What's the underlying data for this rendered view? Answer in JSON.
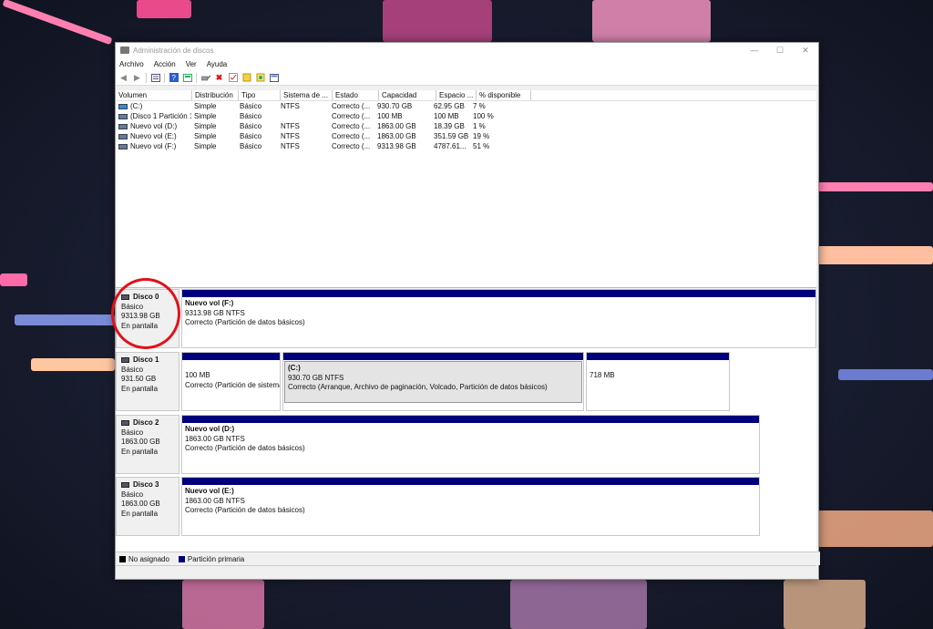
{
  "window": {
    "title": "Administración de discos"
  },
  "menu": [
    "Archivo",
    "Acción",
    "Ver",
    "Ayuda"
  ],
  "toolbar_icons": [
    "back-arrow-icon",
    "forward-arrow-icon",
    "disk-list-icon",
    "help-icon",
    "properties-icon",
    "connect-icon",
    "delete-icon",
    "check-icon",
    "open-folder-icon",
    "rescan-icon",
    "volume-view-icon"
  ],
  "table": {
    "headers": [
      "Volumen",
      "Distribución",
      "Tipo",
      "Sistema de ...",
      "Estado",
      "Capacidad",
      "Espacio ...",
      "% disponible"
    ],
    "rows": [
      [
        "(C:)",
        "Simple",
        "Básico",
        "NTFS",
        "Correcto (...",
        "930.70 GB",
        "62.95 GB",
        "7 %"
      ],
      [
        "(Disco 1 Partición 1)",
        "Simple",
        "Básico",
        "",
        "Correcto (...",
        "100 MB",
        "100 MB",
        "100 %"
      ],
      [
        "Nuevo vol (D:)",
        "Simple",
        "Básico",
        "NTFS",
        "Correcto (...",
        "1863.00 GB",
        "18.39 GB",
        "1 %"
      ],
      [
        "Nuevo vol (E:)",
        "Simple",
        "Básico",
        "NTFS",
        "Correcto (...",
        "1863.00 GB",
        "351.59 GB",
        "19 %"
      ],
      [
        "Nuevo vol (F:)",
        "Simple",
        "Básico",
        "NTFS",
        "Correcto (...",
        "9313.98 GB",
        "4787.61...",
        "51 %"
      ]
    ]
  },
  "disks": [
    {
      "name": "Disco 0",
      "type": "Básico",
      "size": "9313.98 GB",
      "status": "En pantalla",
      "partitions": [
        {
          "name": "Nuevo vol  (F:)",
          "size": "9313.98 GB NTFS",
          "status": "Correcto (Partición de datos básicos)"
        }
      ]
    },
    {
      "name": "Disco 1",
      "type": "Básico",
      "size": "931.50 GB",
      "status": "En pantalla",
      "partitions": [
        {
          "name": "",
          "size": "100 MB",
          "status": "Correcto (Partición de sistema"
        },
        {
          "name": "(C:)",
          "size": "930.70 GB NTFS",
          "status": "Correcto (Arranque, Archivo de paginación, Volcado, Partición de datos básicos)"
        },
        {
          "name": "",
          "size": "718 MB",
          "status": ""
        }
      ]
    },
    {
      "name": "Disco 2",
      "type": "Básico",
      "size": "1863.00 GB",
      "status": "En pantalla",
      "partitions": [
        {
          "name": "Nuevo vol  (D:)",
          "size": "1863.00 GB NTFS",
          "status": "Correcto (Partición de datos básicos)"
        }
      ]
    },
    {
      "name": "Disco 3",
      "type": "Básico",
      "size": "1863.00 GB",
      "status": "En pantalla",
      "partitions": [
        {
          "name": "Nuevo vol  (E:)",
          "size": "1863.00 GB NTFS",
          "status": "Correcto (Partición de datos básicos)"
        }
      ]
    }
  ],
  "legend": [
    {
      "label": "No asignado",
      "color": "#000000"
    },
    {
      "label": "Partición primaria",
      "color": "#00007c"
    }
  ],
  "colors": {
    "partition_bar": "#00007c",
    "highlight_circle": "#e0121a"
  }
}
